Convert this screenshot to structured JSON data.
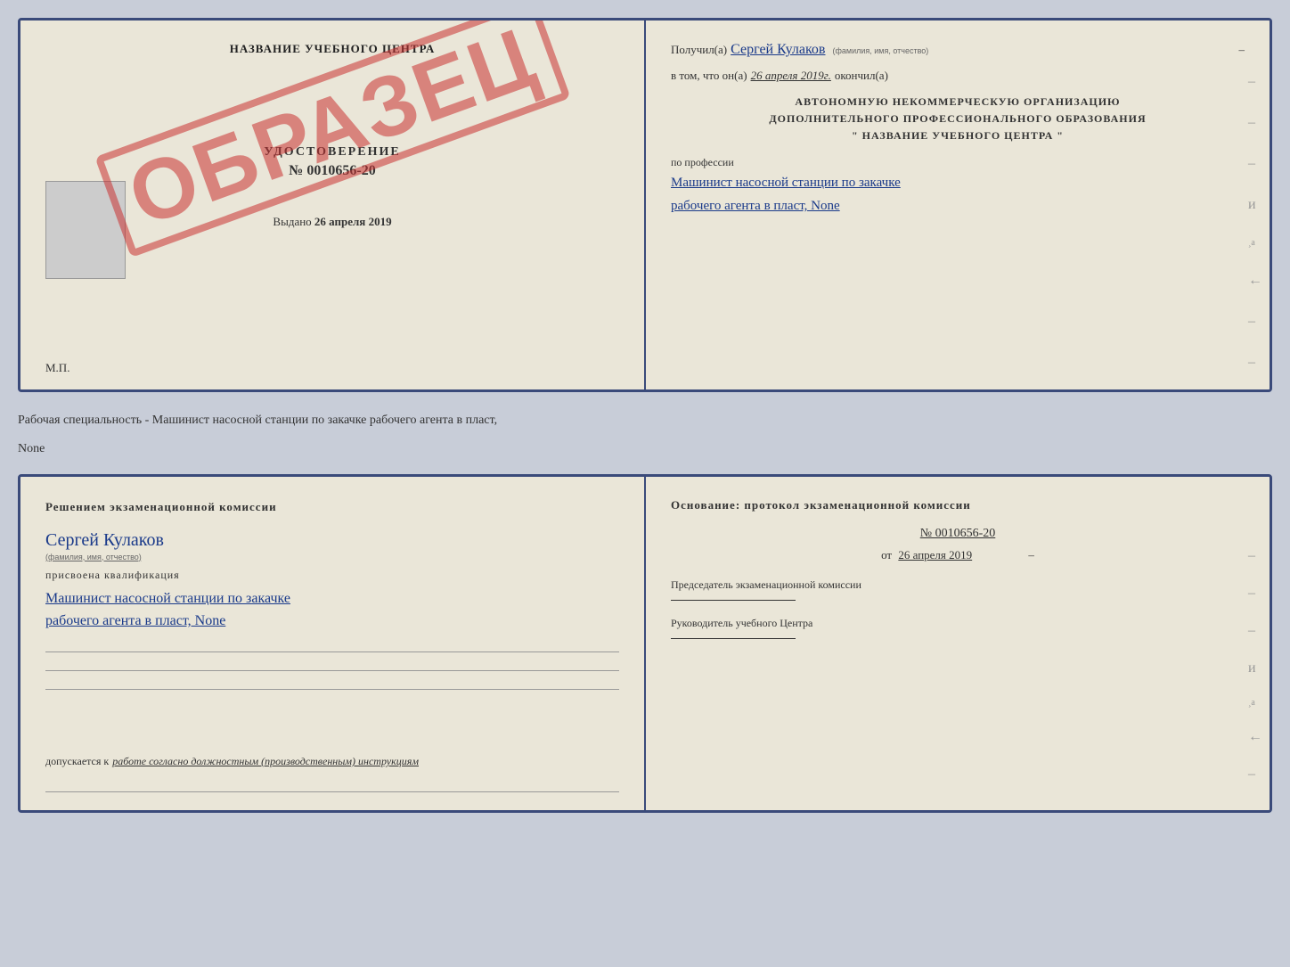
{
  "topDoc": {
    "left": {
      "schoolName": "НАЗВАНИЕ УЧЕБНОГО ЦЕНТРА",
      "obrazec": "ОБРАЗЕЦ",
      "udostoverenie": {
        "title": "УДОСТОВЕРЕНИЕ",
        "number": "№ 0010656-20"
      },
      "vydano": "Выдано",
      "vydanoDate": "26 апреля 2019",
      "mp": "М.П."
    },
    "right": {
      "poluchilLabel": "Получил(а)",
      "poluchilValue": "Сергей Кулаков",
      "familiaLabel": "(фамилия, имя, отчество)",
      "dash": "–",
      "vtomChtoLabel": "в том, что он(а)",
      "vtomDate": "26 апреля 2019г.",
      "okonchilLabel": "окончил(а)",
      "orgLine1": "АВТОНОМНУЮ НЕКОММЕРЧЕСКУЮ ОРГАНИЗАЦИЮ",
      "orgLine2": "ДОПОЛНИТЕЛЬНОГО ПРОФЕССИОНАЛЬНОГО ОБРАЗОВАНИЯ",
      "orgLine3": "\"   НАЗВАНИЕ УЧЕБНОГО ЦЕНТРА   \"",
      "poProfessii": "по профессии",
      "profession1": "Машинист насосной станции по закачке",
      "profession2": "рабочего агента в пласт, None"
    }
  },
  "specialtyLine": "Рабочая специальность - Машинист насосной станции по закачке рабочего агента в пласт,",
  "specialtyLine2": "None",
  "bottomDoc": {
    "left": {
      "resheniemText": "Решением  экзаменационной  комиссии",
      "nameValue": "Сергей Кулаков",
      "nameLabel": "(фамилия, имя, отчество)",
      "prisvoenLabel": "присвоена квалификация",
      "qual1": "Машинист насосной станции по закачке",
      "qual2": "рабочего агента в пласт, None",
      "dopuskaetsyaLabel": "допускается к",
      "dopuskaetsyaValue": "работе согласно должностным (производственным) инструкциям"
    },
    "right": {
      "osnovanie": "Основание:  протокол  экзаменационной  комиссии",
      "protocolNumber": "№ 0010656-20",
      "protocolDatePrefix": "от",
      "protocolDate": "26 апреля 2019",
      "predsedatelLabel": "Председатель экзаменационной комиссии",
      "rukovoditelLabel": "Руководитель учебного Центра"
    }
  }
}
